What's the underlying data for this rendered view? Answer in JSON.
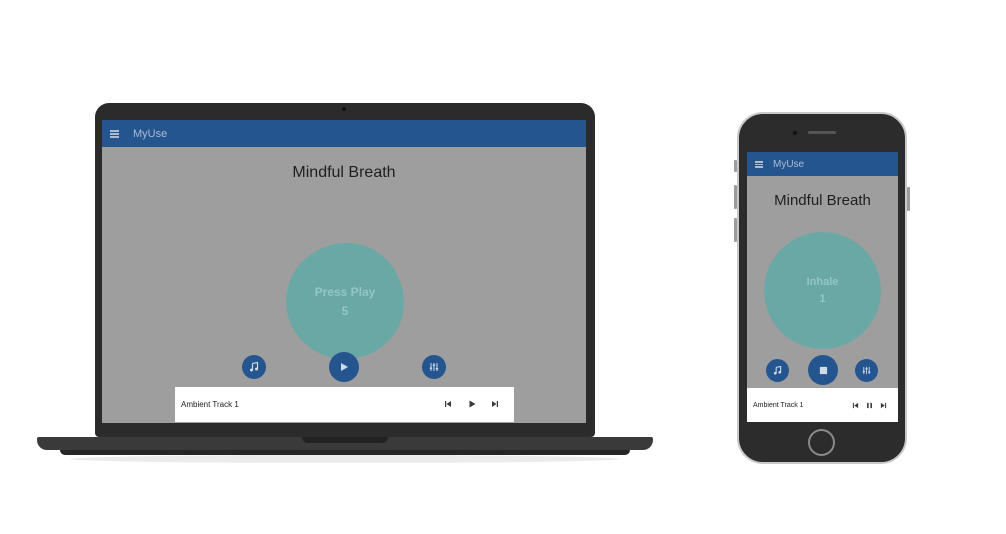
{
  "app": {
    "name": "MyUse",
    "title": "Mindful Breath"
  },
  "laptop": {
    "circle_label": "Press Play",
    "circle_count": "5",
    "track_name": "Ambient Track 1",
    "playback_state": "paused"
  },
  "phone": {
    "circle_label": "Inhale",
    "circle_count": "1",
    "track_name": "Ambient Track 1",
    "playback_state": "playing"
  },
  "colors": {
    "appbar": "#25558e",
    "circle": "#6aa8a6",
    "screen_dim": "#9e9e9e",
    "device_frame": "#2b2b2b"
  },
  "icons": [
    "menu-icon",
    "music-note-icon",
    "play-icon",
    "stop-icon",
    "equalizer-icon",
    "skip-previous-icon",
    "pause-icon",
    "skip-next-icon"
  ]
}
